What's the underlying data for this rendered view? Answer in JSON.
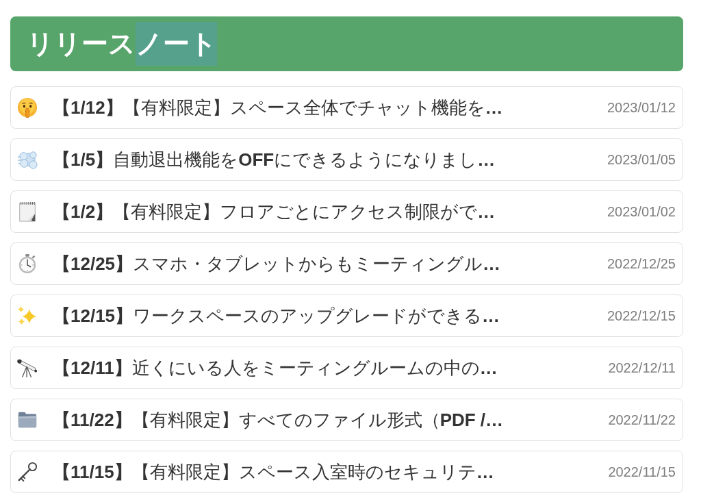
{
  "header": {
    "title_parts": [
      {
        "text": "リリース",
        "selected": false
      },
      {
        "text": "ノート",
        "selected": true
      }
    ]
  },
  "notes": [
    {
      "kind": "face",
      "title": "**【1/12】**【有料限定】スペース全体でチャット機能を**…**",
      "date": "2023/01/12"
    },
    {
      "kind": "cloud",
      "title": "**【1/5】**自動退出機能を**OFF**にできるようになりまし**…**",
      "date": "2023/01/05"
    },
    {
      "kind": "notepad",
      "title": "**【1/2】**【有料限定】フロアごとにアクセス制限がで**…**",
      "date": "2023/01/02"
    },
    {
      "kind": "stopwatch",
      "title": "**【12/25】**スマホ・タブレットからもミーティングル**…**",
      "date": "2022/12/25"
    },
    {
      "kind": "sparkles",
      "title": "**【12/15】**ワークスペースのアップグレードができる**…**",
      "date": "2022/12/15"
    },
    {
      "kind": "telescope",
      "title": "**【12/11】**近くにいる人をミーティングルームの中の**…**",
      "date": "2022/12/11"
    },
    {
      "kind": "folder",
      "title": "**【11/22】**【有料限定】すべてのファイル形式（**PDF /…**",
      "date": "2022/11/22"
    },
    {
      "kind": "key",
      "title": "**【11/15】**【有料限定】スペース入室時のセキュリテ**…**",
      "date": "2022/11/15"
    }
  ]
}
